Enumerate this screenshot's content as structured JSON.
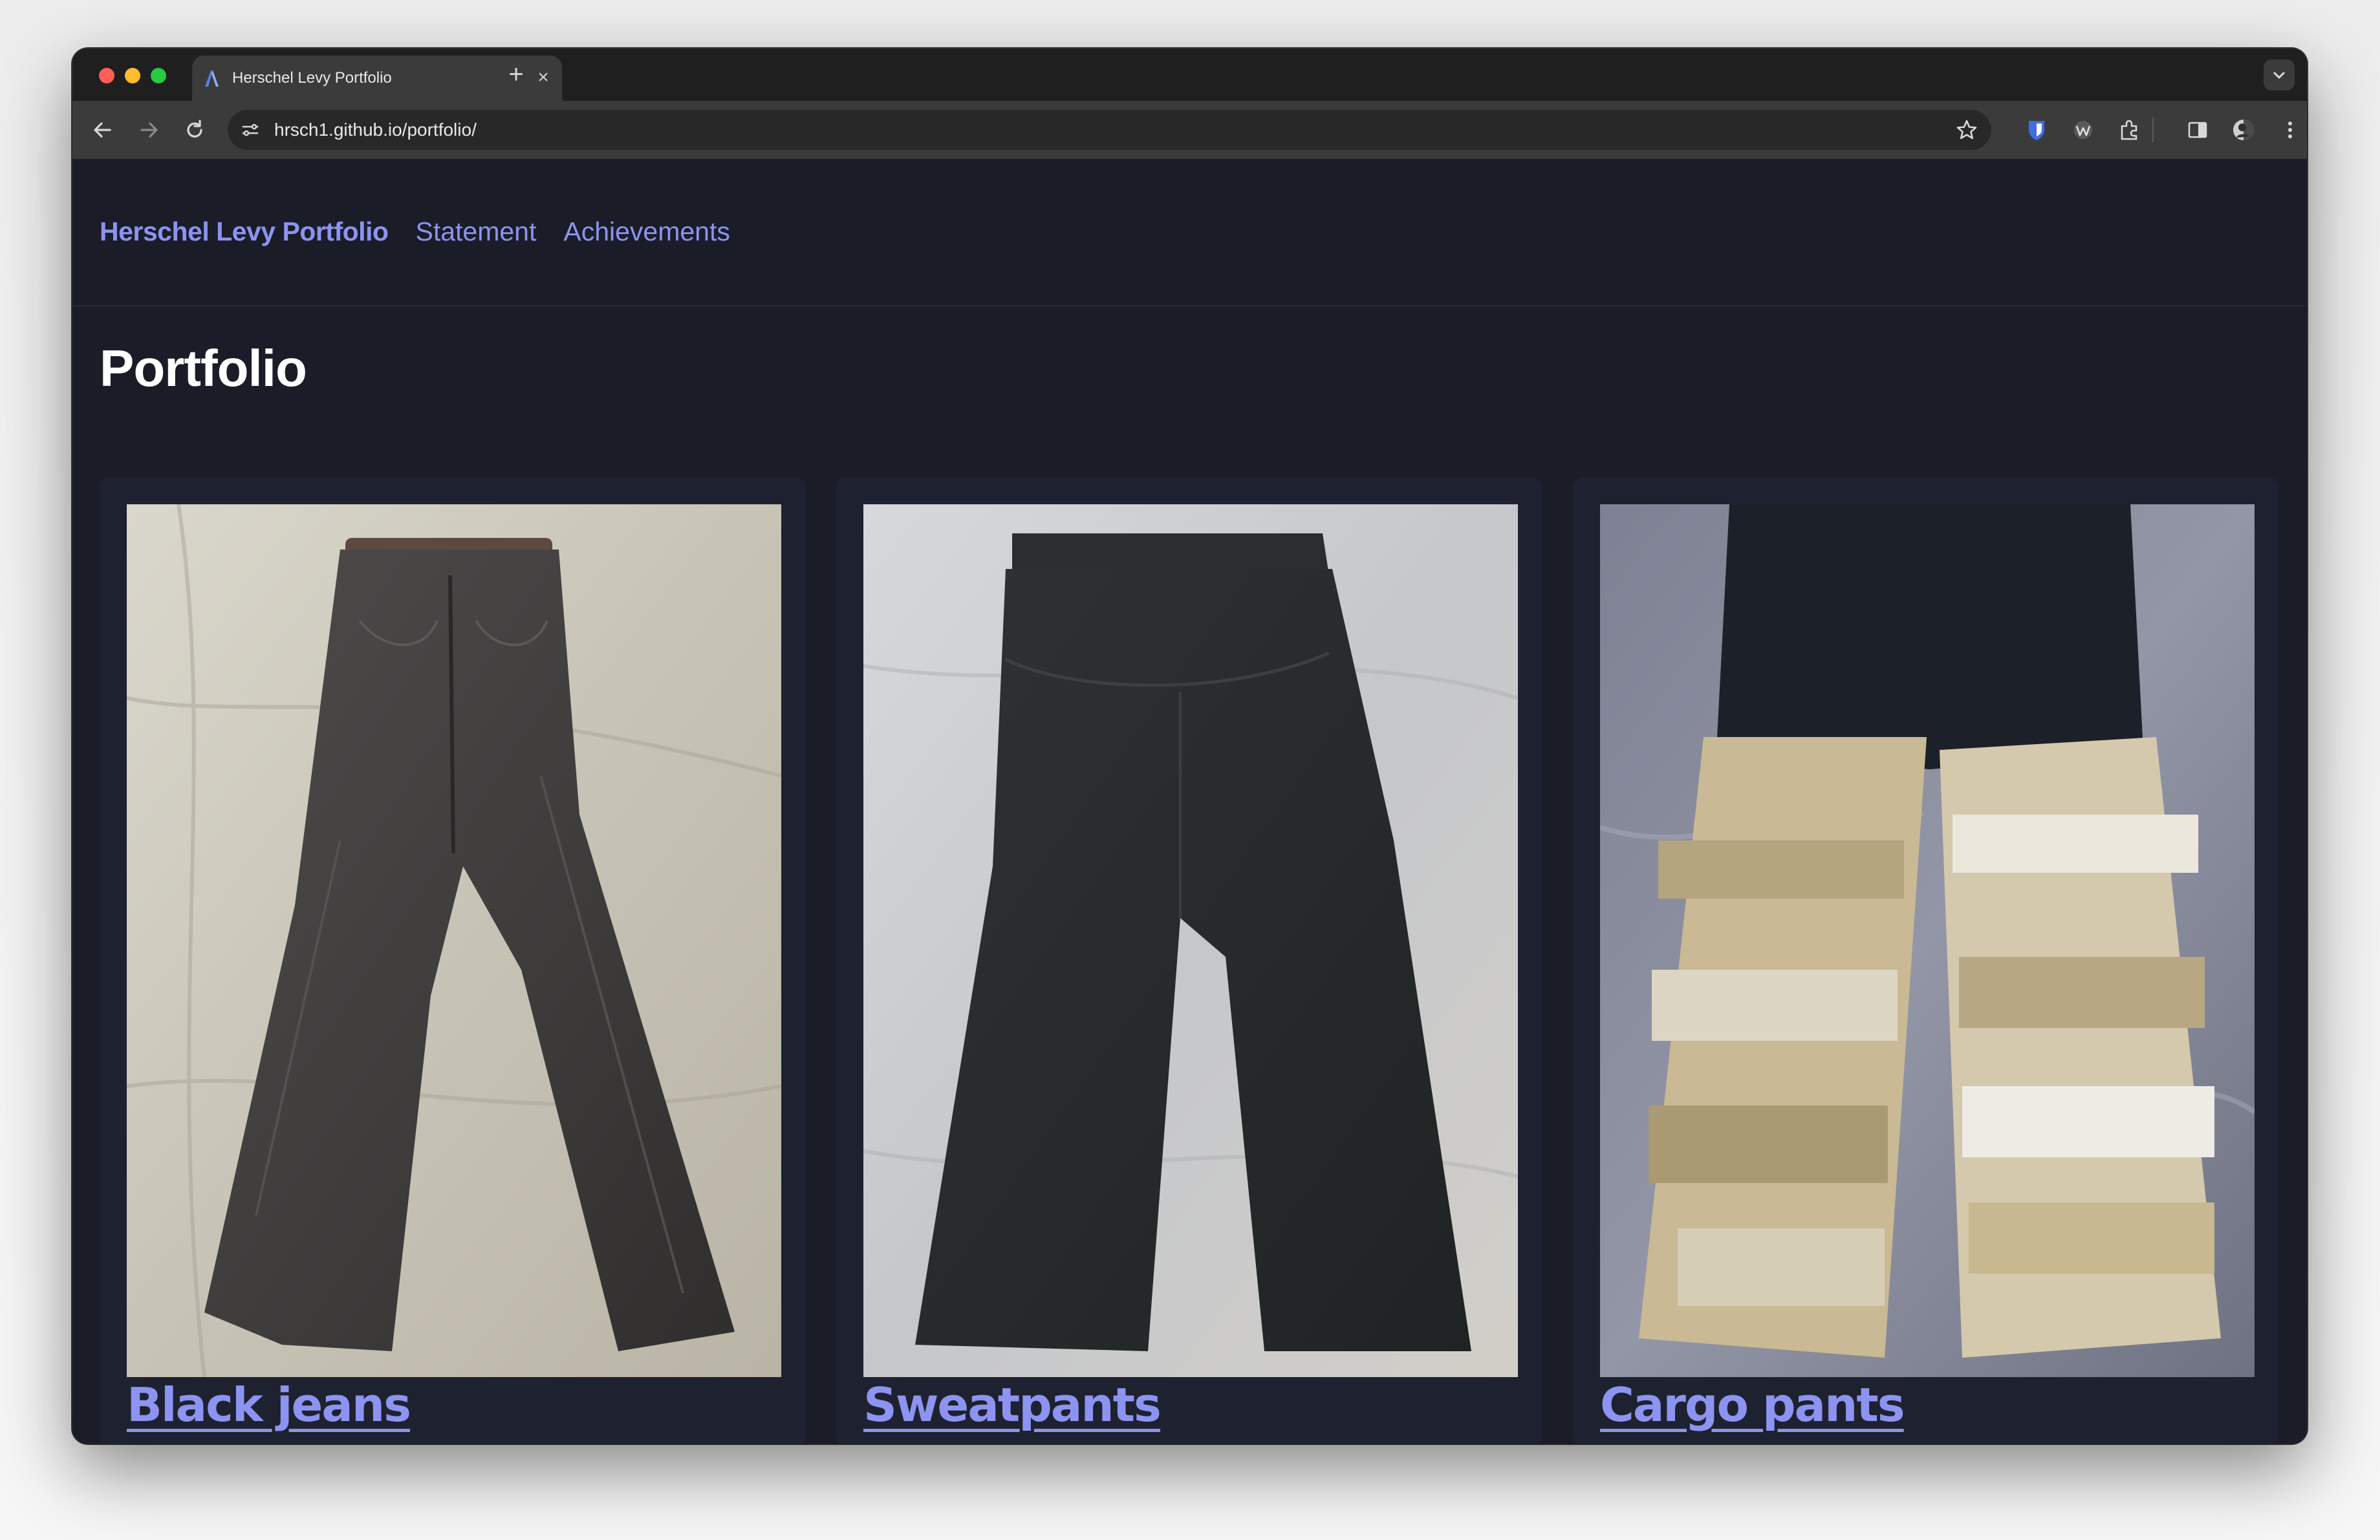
{
  "browser": {
    "tab_title": "Herschel Levy Portfolio",
    "url": "hrsch1.github.io/portfolio/",
    "new_tab_symbol": "+",
    "close_symbol": "×"
  },
  "site": {
    "brand": "Herschel Levy Portfolio",
    "nav": [
      "Statement",
      "Achievements"
    ],
    "heading": "Portfolio"
  },
  "items": [
    {
      "title": "Black jeans"
    },
    {
      "title": "Sweatpants"
    },
    {
      "title": "Cargo pants"
    }
  ],
  "colors": {
    "page_bg": "#1a1d28",
    "card_bg": "#1e2230",
    "link": "#8c93f0",
    "heading": "#ffffff"
  }
}
